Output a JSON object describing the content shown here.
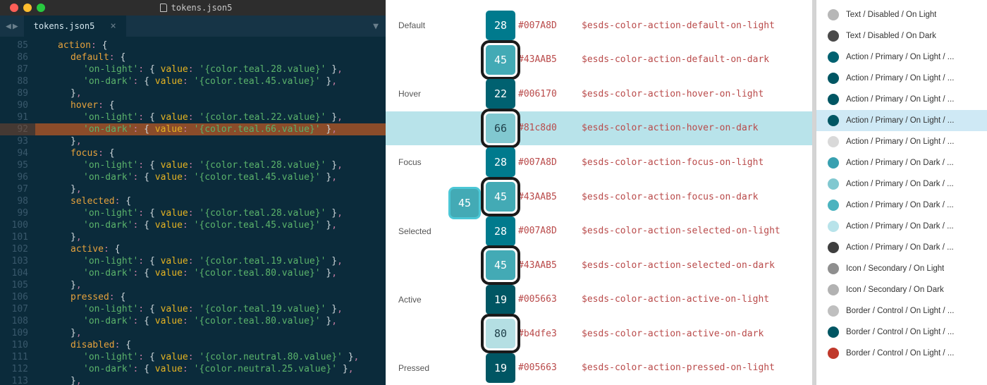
{
  "editor": {
    "title": "tokens.json5",
    "tab": {
      "label": "tokens.json5"
    },
    "startLine": 85,
    "highlightLine": 92,
    "lines": [
      {
        "indent": 1,
        "kind": "open",
        "key": "action"
      },
      {
        "indent": 2,
        "kind": "open",
        "key": "default"
      },
      {
        "indent": 3,
        "kind": "kv",
        "key": "on-light",
        "val": "{color.teal.28.value}"
      },
      {
        "indent": 3,
        "kind": "kv",
        "key": "on-dark",
        "val": "{color.teal.45.value}"
      },
      {
        "indent": 2,
        "kind": "close"
      },
      {
        "indent": 2,
        "kind": "open",
        "key": "hover"
      },
      {
        "indent": 3,
        "kind": "kv",
        "key": "on-light",
        "val": "{color.teal.22.value}"
      },
      {
        "indent": 3,
        "kind": "kv",
        "key": "on-dark",
        "val": "{color.teal.66.value}",
        "hl": true
      },
      {
        "indent": 2,
        "kind": "close"
      },
      {
        "indent": 2,
        "kind": "open",
        "key": "focus"
      },
      {
        "indent": 3,
        "kind": "kv",
        "key": "on-light",
        "val": "{color.teal.28.value}"
      },
      {
        "indent": 3,
        "kind": "kv",
        "key": "on-dark",
        "val": "{color.teal.45.value}"
      },
      {
        "indent": 2,
        "kind": "close"
      },
      {
        "indent": 2,
        "kind": "open",
        "key": "selected"
      },
      {
        "indent": 3,
        "kind": "kv",
        "key": "on-light",
        "val": "{color.teal.28.value}"
      },
      {
        "indent": 3,
        "kind": "kv",
        "key": "on-dark",
        "val": "{color.teal.45.value}"
      },
      {
        "indent": 2,
        "kind": "close"
      },
      {
        "indent": 2,
        "kind": "open",
        "key": "active"
      },
      {
        "indent": 3,
        "kind": "kv",
        "key": "on-light",
        "val": "{color.teal.19.value}"
      },
      {
        "indent": 3,
        "kind": "kv",
        "key": "on-dark",
        "val": "{color.teal.80.value}"
      },
      {
        "indent": 2,
        "kind": "close"
      },
      {
        "indent": 2,
        "kind": "open",
        "key": "pressed"
      },
      {
        "indent": 3,
        "kind": "kv",
        "key": "on-light",
        "val": "{color.teal.19.value}"
      },
      {
        "indent": 3,
        "kind": "kv",
        "key": "on-dark",
        "val": "{color.teal.80.value}"
      },
      {
        "indent": 2,
        "kind": "close"
      },
      {
        "indent": 2,
        "kind": "open",
        "key": "disabled"
      },
      {
        "indent": 3,
        "kind": "kv",
        "key": "on-light",
        "val": "{color.neutral.80.value}"
      },
      {
        "indent": 3,
        "kind": "kv",
        "key": "on-dark",
        "val": "{color.neutral.25.value}"
      },
      {
        "indent": 2,
        "kind": "close"
      }
    ]
  },
  "doc": {
    "drag": {
      "label": "45",
      "color": "#43AAB5"
    },
    "rows": [
      {
        "section": "Default",
        "num": "28",
        "swatch": "#007A8D",
        "hex": "#007A8D",
        "token": "$esds-color-action-default-on-light",
        "dark": false
      },
      {
        "section": "",
        "num": "45",
        "swatch": "#43AAB5",
        "hex": "#43AAB5",
        "token": "$esds-color-action-default-on-dark",
        "dark": true
      },
      {
        "section": "Hover",
        "num": "22",
        "swatch": "#006170",
        "hex": "#006170",
        "token": "$esds-color-action-hover-on-light",
        "dark": false
      },
      {
        "section": "",
        "num": "66",
        "swatch": "#81c8d0",
        "hex": "#81c8d0",
        "token": "$esds-color-action-hover-on-dark",
        "dark": true,
        "highlight": true,
        "lightText": true
      },
      {
        "section": "Focus",
        "num": "28",
        "swatch": "#007A8D",
        "hex": "#007A8D",
        "token": "$esds-color-action-focus-on-light",
        "dark": false
      },
      {
        "section": "",
        "num": "45",
        "swatch": "#43AAB5",
        "hex": "#43AAB5",
        "token": "$esds-color-action-focus-on-dark",
        "dark": true,
        "hasDrag": true
      },
      {
        "section": "Selected",
        "num": "28",
        "swatch": "#007A8D",
        "hex": "#007A8D",
        "token": "$esds-color-action-selected-on-light",
        "dark": false
      },
      {
        "section": "",
        "num": "45",
        "swatch": "#43AAB5",
        "hex": "#43AAB5",
        "token": "$esds-color-action-selected-on-dark",
        "dark": true
      },
      {
        "section": "Active",
        "num": "19",
        "swatch": "#005663",
        "hex": "#005663",
        "token": "$esds-color-action-active-on-light",
        "dark": false
      },
      {
        "section": "",
        "num": "80",
        "swatch": "#b4dfe3",
        "hex": "#b4dfe3",
        "token": "$esds-color-action-active-on-dark",
        "dark": true,
        "lightText": true
      },
      {
        "section": "Pressed",
        "num": "19",
        "swatch": "#005663",
        "hex": "#005663",
        "token": "$esds-color-action-pressed-on-light",
        "dark": false
      }
    ]
  },
  "sidebar": {
    "items": [
      {
        "label": "Text / Disabled / On Light",
        "color": "#b7b7b7"
      },
      {
        "label": "Text / Disabled / On Dark",
        "color": "#4a4a4a"
      },
      {
        "label": "Action / Primary / On Light / ...",
        "color": "#006170"
      },
      {
        "label": "Action / Primary / On Light / ...",
        "color": "#005663"
      },
      {
        "label": "Action / Primary / On Light / ...",
        "color": "#005663"
      },
      {
        "label": "Action / Primary / On Light / ...",
        "color": "#005663",
        "selected": true
      },
      {
        "label": "Action / Primary / On Light / ...",
        "color": "#d9d9d9"
      },
      {
        "label": "Action / Primary / On Dark / ...",
        "color": "#38a0b0"
      },
      {
        "label": "Action / Primary / On Dark / ...",
        "color": "#81c8d0"
      },
      {
        "label": "Action / Primary / On Dark / ...",
        "color": "#4bb3bf"
      },
      {
        "label": "Action / Primary / On Dark / ...",
        "color": "#b8e3ea"
      },
      {
        "label": "Action / Primary / On Dark / ...",
        "color": "#3f3f3f"
      },
      {
        "label": "Icon / Secondary / On Light",
        "color": "#8f8f8f"
      },
      {
        "label": "Icon / Secondary / On Dark",
        "color": "#b2b2b2"
      },
      {
        "label": "Border / Control / On Light / ...",
        "color": "#bfbfbf"
      },
      {
        "label": "Border / Control / On Light / ...",
        "color": "#005663"
      },
      {
        "label": "Border / Control / On Light / ...",
        "color": "#c0392b"
      }
    ]
  }
}
